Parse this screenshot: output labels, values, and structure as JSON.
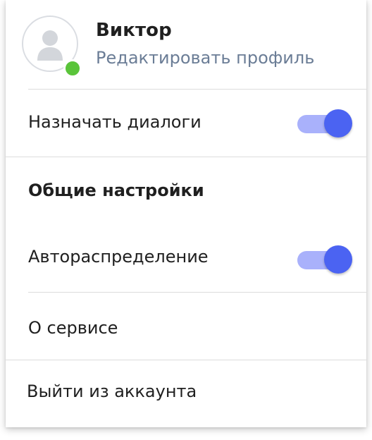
{
  "profile": {
    "name": "Виктор",
    "edit_label": "Редактировать профиль",
    "status": "online",
    "avatar_icon": "user-silhouette-icon",
    "status_color": "#5ac43a",
    "link_color": "#6b7d96"
  },
  "assign_dialogs": {
    "label": "Назначать диалоги",
    "enabled": true
  },
  "general_settings": {
    "title": "Общие настройки",
    "auto_distribution": {
      "label": "Автораспределение",
      "enabled": true
    }
  },
  "about": {
    "label": "О сервисе"
  },
  "logout": {
    "label": "Выйти из аккаунта"
  },
  "colors": {
    "toggle_track": "#a9b1fb",
    "toggle_knob": "#4b63f2",
    "text": "#1f1f1f",
    "divider": "#dcdcdc"
  }
}
